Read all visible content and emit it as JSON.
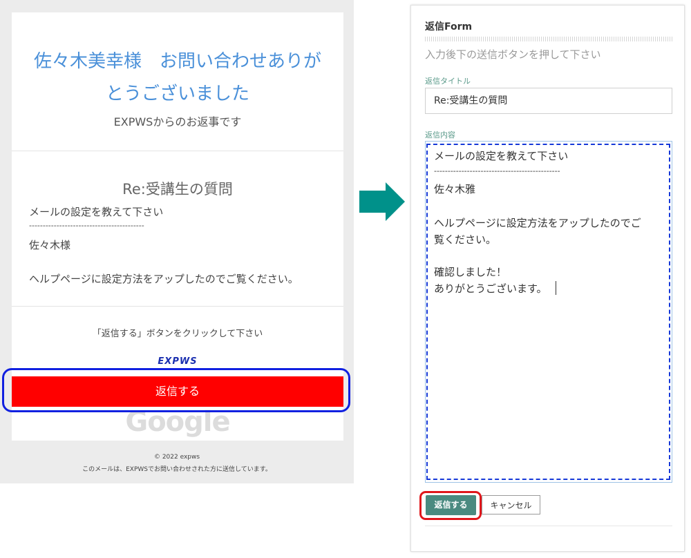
{
  "email": {
    "title_line1": "佐々木美幸様　お問い合わせありが",
    "title_line2": "とうございました",
    "subtitle": "EXPWSからのお返事です",
    "message_title": "Re:受講生の質問",
    "body_lines": [
      "メールの設定を教えて下さい",
      "------------------------------------------",
      "佐々木様",
      "",
      "ヘルプページに設定方法をアップしたのでご覧ください。"
    ],
    "instruction": "「返信する」ボタンをクリックして下さい",
    "brand": "EXPWS",
    "reply_button": "返信する",
    "google_mark": "Google",
    "footer_copyright": "© 2022 expws",
    "footer_note": "このメールは、EXPWSでお問い合わせされた方に送信しています。"
  },
  "form": {
    "heading": "返信Form",
    "description": "入力後下の送信ボタンを押して下さい",
    "title_label": "返信タイトル",
    "title_value": "Re:受講生の質問",
    "content_label": "返信内容",
    "content_lines": [
      "メールの設定を教えて下さい",
      "----------------------------------------------",
      "佐々木雅",
      "",
      "ヘルプページに設定方法をアップしたのでご",
      "覧ください。",
      "",
      "確認しました！",
      "ありがとうございます。"
    ],
    "submit_button": "返信する",
    "cancel_button": "キャンセル"
  },
  "colors": {
    "email_title": "#4a90d9",
    "reply_button_bg": "#ff0000",
    "arrow": "#00918a",
    "submit_bg": "#4a8a80",
    "highlight_blue": "#1020e0",
    "highlight_red": "#e0161b"
  },
  "icons": {
    "arrow": "arrow-right-icon"
  }
}
